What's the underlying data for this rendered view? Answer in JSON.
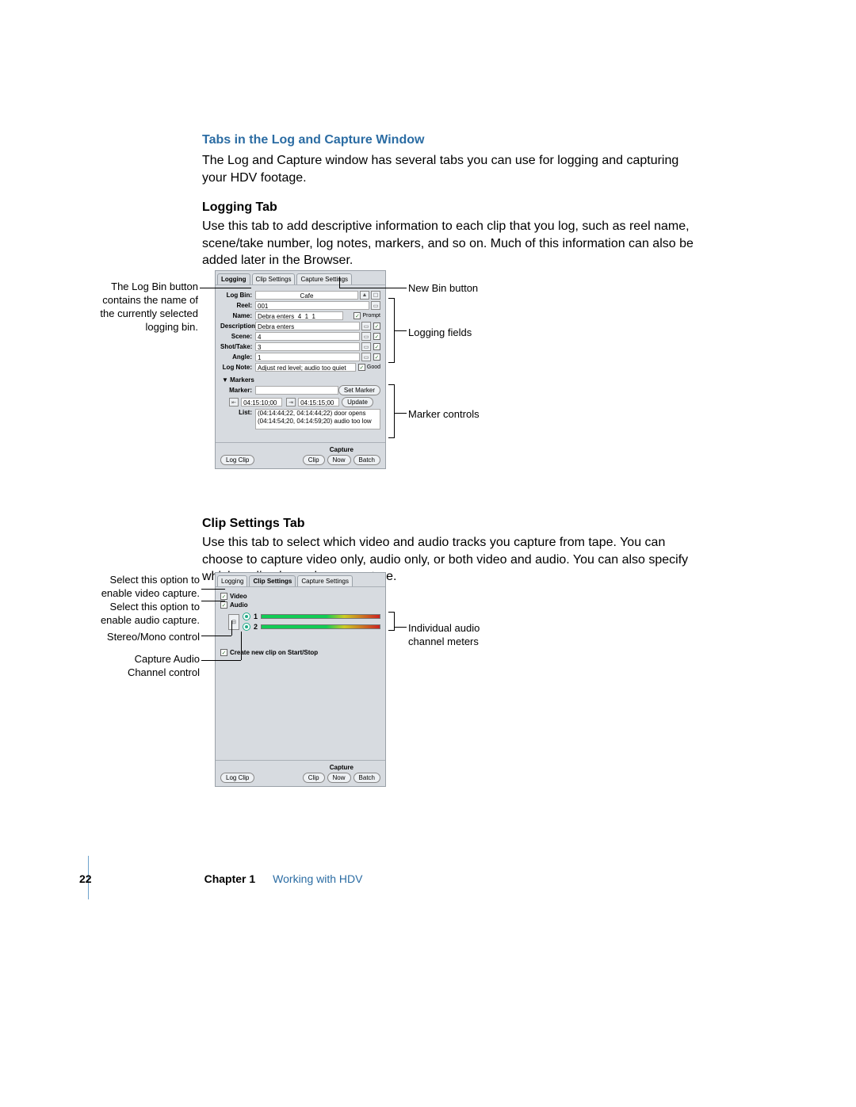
{
  "section_title": "Tabs in the Log and Capture Window",
  "intro_text": "The Log and Capture window has several tabs you can use for logging and capturing your HDV footage.",
  "logging_heading": "Logging Tab",
  "logging_text": "Use this tab to add descriptive information to each clip that you log, such as reel name, scene/take number, log notes, markers, and so on. Much of this information can also be added later in the Browser.",
  "clip_heading": "Clip Settings Tab",
  "clip_text": "Use this tab to select which video and audio tracks you capture from tape. You can choose to capture video only, audio only, or both video and audio. You can also specify which audio channels you capture.",
  "tabs": {
    "logging": "Logging",
    "clip": "Clip Settings",
    "capture": "Capture Settings"
  },
  "fig1": {
    "log_bin_label": "Log Bin:",
    "log_bin_value": "Cafe",
    "reel_label": "Reel:",
    "reel_value": "001",
    "name_label": "Name:",
    "name_value": "Debra enters_4_1_1",
    "prompt_label": "Prompt",
    "desc_label": "Description:",
    "desc_value": "Debra enters",
    "scene_label": "Scene:",
    "scene_value": "4",
    "shot_label": "Shot/Take:",
    "shot_value": "3",
    "angle_label": "Angle:",
    "angle_value": "1",
    "lognote_label": "Log Note:",
    "lognote_value": "Adjust red level; audio too quiet",
    "good_label": "Good",
    "markers_heading": "Markers",
    "marker_label": "Marker:",
    "set_marker_btn": "Set Marker",
    "tc_in": "04:15:10;00",
    "tc_out": "04:15:15;00",
    "update_btn": "Update",
    "list_label": "List:",
    "list_line1": "(04:14:44;22, 04:14:44;22) door opens",
    "list_line2": "(04:14:54;20, 04:14:59;20) audio too low",
    "capture_label": "Capture",
    "log_clip_btn": "Log Clip",
    "clip_btn": "Clip",
    "now_btn": "Now",
    "batch_btn": "Batch"
  },
  "fig2": {
    "video_label": "Video",
    "audio_label": "Audio",
    "ch1": "1",
    "ch2": "2",
    "create_label": "Create new clip on Start/Stop",
    "capture_label": "Capture",
    "log_clip_btn": "Log Clip",
    "clip_btn": "Clip",
    "now_btn": "Now",
    "batch_btn": "Batch"
  },
  "callouts": {
    "logbin": "The Log Bin button contains the name of the currently selected logging bin.",
    "newbin": "New Bin button",
    "logfields": "Logging fields",
    "markers": "Marker controls",
    "video_opt": "Select this option to enable video capture.",
    "audio_opt": "Select this option to enable audio capture.",
    "stereo": "Stereo/Mono control",
    "capaudio": "Capture Audio Channel control",
    "meters": "Individual audio channel meters"
  },
  "footer": {
    "page": "22",
    "chapter": "Chapter 1",
    "title": "Working with HDV"
  }
}
